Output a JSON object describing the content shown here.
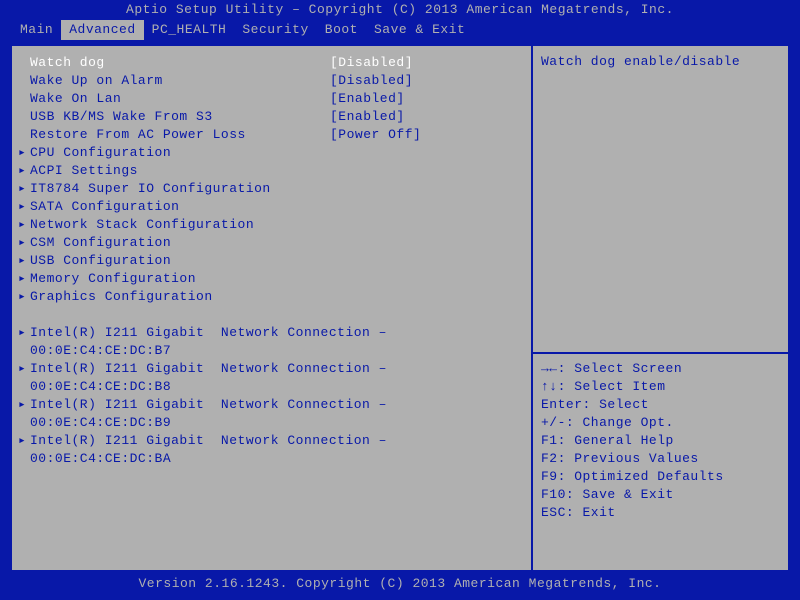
{
  "title": "Aptio Setup Utility – Copyright (C) 2013 American Megatrends, Inc.",
  "tabs": [
    "Main",
    "Advanced",
    "PC_HEALTH",
    "Security",
    "Boot",
    "Save & Exit"
  ],
  "active_tab": 1,
  "settings": [
    {
      "label": "Watch dog",
      "value": "[Disabled]",
      "selected": true
    },
    {
      "label": "Wake Up on Alarm",
      "value": "[Disabled]"
    },
    {
      "label": "Wake On Lan",
      "value": "[Enabled]"
    },
    {
      "label": "USB KB/MS Wake From S3",
      "value": "[Enabled]"
    },
    {
      "label": "Restore From AC Power Loss",
      "value": "[Power Off]"
    }
  ],
  "submenus": [
    "CPU Configuration",
    "ACPI Settings",
    "IT8784 Super IO Configuration",
    "SATA Configuration",
    "Network Stack Configuration",
    "CSM Configuration",
    "USB Configuration",
    "Memory Configuration",
    "Graphics Configuration"
  ],
  "nics": [
    {
      "line1": "Intel(R) I211 Gigabit  Network Connection –",
      "line2": "00:0E:C4:CE:DC:B7"
    },
    {
      "line1": "Intel(R) I211 Gigabit  Network Connection –",
      "line2": "00:0E:C4:CE:DC:B8"
    },
    {
      "line1": "Intel(R) I211 Gigabit  Network Connection –",
      "line2": "00:0E:C4:CE:DC:B9"
    },
    {
      "line1": "Intel(R) I211 Gigabit  Network Connection –",
      "line2": "00:0E:C4:CE:DC:BA"
    }
  ],
  "help": "Watch dog enable/disable",
  "keys": {
    "k0": "→←: Select Screen",
    "k1": "↑↓: Select Item",
    "k2": "Enter: Select",
    "k3": "+/-: Change Opt.",
    "k4": "F1: General Help",
    "k5": "F2: Previous Values",
    "k6": "F9: Optimized Defaults",
    "k7": "F10: Save & Exit",
    "k8": "ESC: Exit"
  },
  "footer": "Version 2.16.1243. Copyright (C) 2013 American Megatrends, Inc."
}
